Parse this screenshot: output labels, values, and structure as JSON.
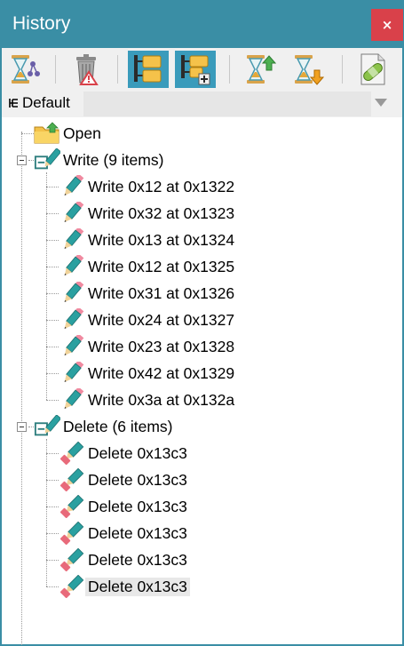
{
  "window": {
    "title": "History",
    "close_label": "×"
  },
  "toolbar": {
    "buttons": [
      {
        "name": "hourglass-tree-icon"
      },
      {
        "name": "trash-icon"
      },
      {
        "name": "branch-view-icon",
        "active": true
      },
      {
        "name": "branch-add-icon",
        "active": true
      },
      {
        "name": "undo-icon"
      },
      {
        "name": "redo-icon"
      },
      {
        "name": "patch-icon"
      }
    ]
  },
  "dropdown": {
    "pin_icon": "⊣",
    "label": "Default",
    "value": ""
  },
  "tree": {
    "root": {
      "label": "Open"
    },
    "groups": [
      {
        "label": "Write (9 items)",
        "items": [
          "Write 0x12 at 0x1322",
          "Write 0x32 at 0x1323",
          "Write 0x13 at 0x1324",
          "Write 0x12 at 0x1325",
          "Write 0x31 at 0x1326",
          "Write 0x24 at 0x1327",
          "Write 0x23 at 0x1328",
          "Write 0x42 at 0x1329",
          "Write 0x3a at 0x132a"
        ]
      },
      {
        "label": "Delete (6 items)",
        "items": [
          "Delete 0x13c3",
          "Delete 0x13c3",
          "Delete 0x13c3",
          "Delete 0x13c3",
          "Delete 0x13c3",
          "Delete 0x13c3"
        ]
      }
    ]
  }
}
